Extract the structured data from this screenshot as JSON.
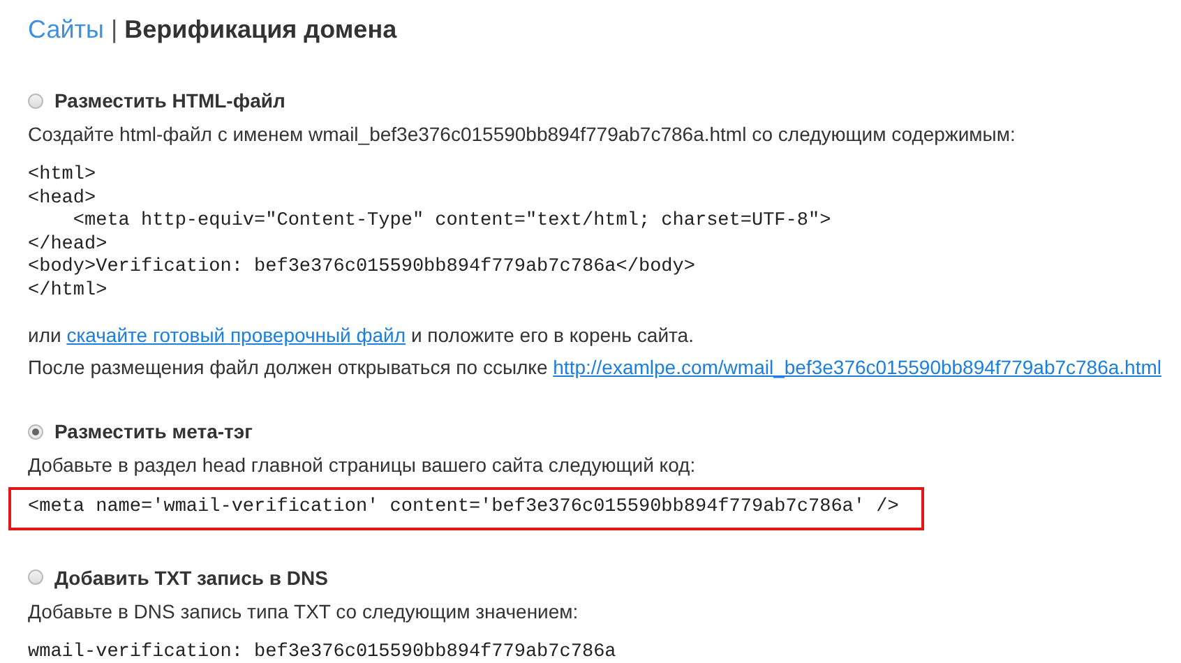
{
  "header": {
    "breadcrumb_link": "Сайты",
    "separator": "|",
    "title": "Верификация домена"
  },
  "options": [
    {
      "label": "Разместить HTML-файл",
      "selected": false,
      "description": "Создайте html-файл с именем wmail_bef3e376c015590bb894f779ab7c786a.html со следующим содержимым:",
      "code": {
        "highlighted": false,
        "lines": [
          "<html>",
          "<head>",
          "    <meta http-equiv=\"Content-Type\" content=\"text/html; charset=UTF-8\">",
          "</head>",
          "<body>Verification: bef3e376c015590bb894f779ab7c786a</body>",
          "</html>"
        ]
      },
      "notes": [
        [
          {
            "kind": "text",
            "text": "или "
          },
          {
            "kind": "link",
            "text": "скачайте готовый проверочный файл"
          },
          {
            "kind": "text",
            "text": " и положите его в корень сайта."
          }
        ],
        [
          {
            "kind": "text",
            "text": "После размещения файл должен открываться по ссылке "
          },
          {
            "kind": "link",
            "text": "http://examlpe.com/wmail_bef3e376c015590bb894f779ab7c786a.html"
          }
        ]
      ]
    },
    {
      "label": "Разместить мета-тэг",
      "selected": true,
      "description": "Добавьте в раздел head главной страницы вашего сайта следующий код:",
      "code": {
        "highlighted": true,
        "lines": [
          "<meta name='wmail-verification' content='bef3e376c015590bb894f779ab7c786a' />"
        ]
      }
    },
    {
      "label": "Добавить TXT запись в DNS",
      "selected": false,
      "description": "Добавьте в DNS запись типа TXT со следующим значением:",
      "code": {
        "highlighted": false,
        "lines": [
          "wmail-verification: bef3e376c015590bb894f779ab7c786a"
        ]
      }
    }
  ]
}
